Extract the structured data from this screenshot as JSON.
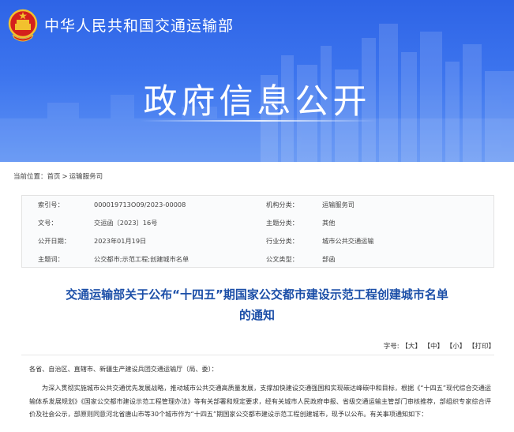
{
  "header": {
    "ministry_name": "中华人民共和国交通运输部",
    "banner_title": "政府信息公开"
  },
  "breadcrumb": {
    "label": "当前位置：",
    "home": "首页",
    "separator": ">",
    "current": "运输服务司"
  },
  "meta": {
    "rows": [
      {
        "k1": "索引号：",
        "v1": "000019713O09/2023-00008",
        "k2": "机构分类：",
        "v2": "运输服务司"
      },
      {
        "k1": "文号：",
        "v1": "交运函〔2023〕16号",
        "k2": "主题分类：",
        "v2": "其他"
      },
      {
        "k1": "公开日期：",
        "v1": "2023年01月19日",
        "k2": "行业分类：",
        "v2": "城市公共交通运输"
      },
      {
        "k1": "主题词：",
        "v1": "公交都市;示范工程;创建城市名单",
        "k2": "公文类型：",
        "v2": "部函"
      }
    ]
  },
  "article": {
    "title_line1": "交通运输部关于公布“十四五”期国家公交都市建设示范工程创建城市名单",
    "title_line2": "的通知"
  },
  "font_tools": {
    "label": "字号:",
    "large": "【大】",
    "medium": "【中】",
    "small": "【小】",
    "print": "【打印】"
  },
  "body": {
    "salutation": "各省、自治区、直辖市、新疆生产建设兵团交通运输厅（局、委）：",
    "paragraph1": "为深入贯彻实施城市公共交通优先发展战略，推动城市公共交通高质量发展，支撑加快建设交通强国和实现碳达峰碳中和目标，根据《“十四五”现代综合交通运输体系发展规划》《国家公交都市建设示范工程管理办法》等有关部署和规定要求，经有关城市人民政府申报、省级交通运输主管部门审核推荐，部组织专家综合评价及社会公示，部原则同意河北省唐山市等30个城市作为“十四五”期国家公交都市建设示范工程创建城市，现予以公布。有关事项通知如下："
  },
  "colors": {
    "banner_blue": "#2e64e6",
    "title_blue": "#1c4fa8"
  }
}
